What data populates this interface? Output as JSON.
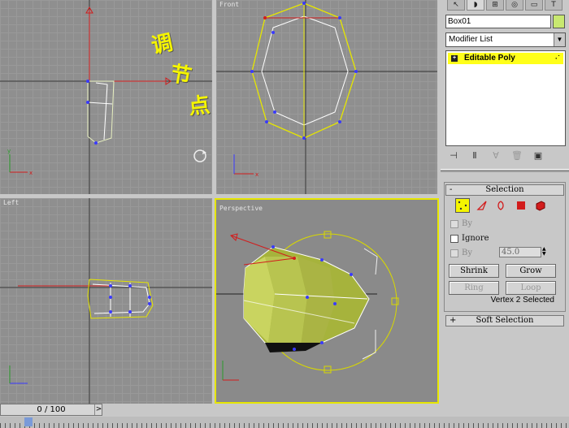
{
  "viewports": {
    "top": {
      "label": ""
    },
    "front": {
      "label": "Front"
    },
    "left": {
      "label": "Left"
    },
    "perspective": {
      "label": "Perspective"
    }
  },
  "annotation": {
    "chars": [
      "调",
      "节",
      "点"
    ]
  },
  "panel": {
    "tabs": [
      {
        "icon": "create-icon",
        "glyph": "↖"
      },
      {
        "icon": "modify-icon",
        "glyph": "◗"
      },
      {
        "icon": "hierarchy-icon",
        "glyph": "⊞"
      },
      {
        "icon": "motion-icon",
        "glyph": "◎"
      },
      {
        "icon": "display-icon",
        "glyph": "▭"
      },
      {
        "icon": "utilities-icon",
        "glyph": "T"
      }
    ],
    "object_name": "Box01",
    "object_color": "#c8e870",
    "modifier_list": "Modifier List",
    "stack_item": "Editable Poly",
    "selection_title": "Selection",
    "by_vertex_label": "By",
    "ignore_backfacing_label": "Ignore",
    "by_angle_label": "By",
    "angle_value": "45.0",
    "buttons": {
      "shrink": "Shrink",
      "grow": "Grow",
      "ring": "Ring",
      "loop": "Loop"
    },
    "status": "Vertex 2 Selected",
    "soft_selection_title": "Soft Selection",
    "minus_sign": "-",
    "plus_sign": "+"
  },
  "timeline": {
    "frame": "0 / 100",
    "arrow": ">"
  },
  "colors": {
    "highlight": "#f5f500",
    "vertex": "#3a3aff",
    "wire": "#ffffff",
    "selection_wire": "#e6e600",
    "gizmo_red": "#d21c1c"
  }
}
